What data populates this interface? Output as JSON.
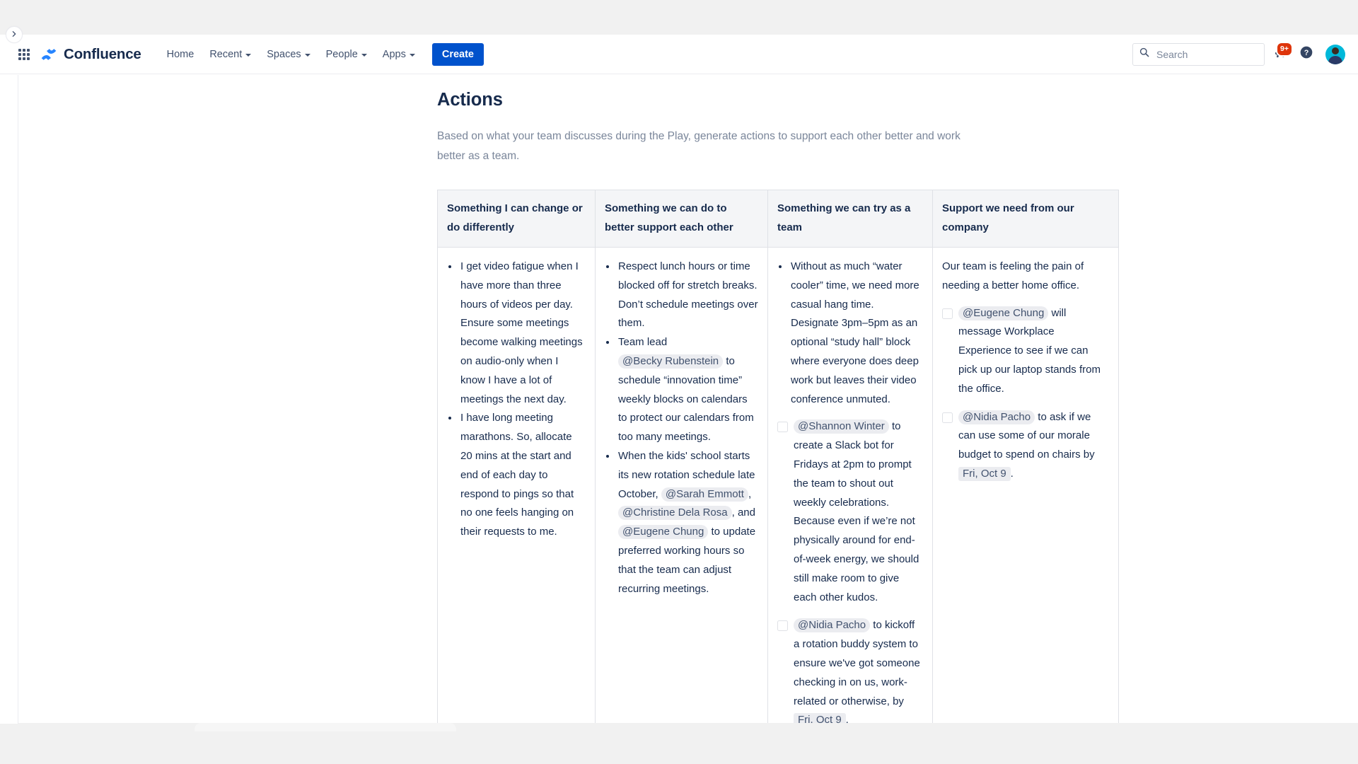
{
  "app": {
    "brand_name": "Confluence",
    "app_switcher_icon": "grid-apps-icon",
    "logo_icon": "confluence-logo-icon"
  },
  "topnav": {
    "items": [
      {
        "label": "Home",
        "has_caret": false
      },
      {
        "label": "Recent",
        "has_caret": true
      },
      {
        "label": "Spaces",
        "has_caret": true
      },
      {
        "label": "People",
        "has_caret": true
      },
      {
        "label": "Apps",
        "has_caret": true
      }
    ],
    "create_label": "Create",
    "search": {
      "placeholder": "Search",
      "value": "",
      "icon": "search-icon"
    },
    "notifications": {
      "badge": "9+",
      "icon": "megaphone-icon"
    },
    "help": {
      "icon": "help-circle-icon"
    },
    "avatar": {
      "icon": "user-avatar"
    }
  },
  "sidebar": {
    "expand_icon": "chevron-right-icon"
  },
  "page": {
    "title": "Actions",
    "subtitle": "Based on what your team discusses during the Play, generate actions to support each other better and work better as a team."
  },
  "table": {
    "headers": [
      "Something I can change or do differently",
      "Something we can do to better support each other",
      "Something we can try as a team",
      "Support we need from our company"
    ],
    "col1": {
      "bullets": [
        "I get video fatigue when I have more than three hours of videos per day. Ensure some meetings become walking meetings on audio-only when I know I have a lot of meetings the next day.",
        "I have long meeting marathons. So, allocate 20 mins at the start and end of each day to respond to pings so that no one feels hanging on their requests to me."
      ]
    },
    "col2": {
      "bullet1": "Respect lunch hours or time blocked off for stretch breaks. Don’t schedule meetings over them.",
      "bullet2_pre": "Team lead",
      "bullet2_mention": "@Becky Rubenstein",
      "bullet2_post": "to schedule “innovation time” weekly blocks on calendars to protect our calendars from too many meetings.",
      "bullet3_pre": "When the kids' school starts its new rotation schedule late October,",
      "bullet3_mention1": "@Sarah Emmott",
      "bullet3_sep1": ",",
      "bullet3_mention2": "@Christine Dela Rosa",
      "bullet3_sep2": ",",
      "bullet3_and": "and",
      "bullet3_mention3": "@Eugene Chung",
      "bullet3_post": "to update preferred working hours so that the team can adjust recurring meetings."
    },
    "col3": {
      "bullet1": "Without as much “water cooler” time, we need more casual hang time. Designate 3pm–5pm as an optional “study hall” block where everyone does deep work but leaves their video conference unmuted.",
      "task1": {
        "checked": false,
        "mention": "@Shannon Winter",
        "text": "to create a Slack bot for Fridays at 2pm to prompt the team to shout out weekly celebrations. Because even if we’re not physically around for end-of-week energy, we should still make room to give each other kudos."
      },
      "task2": {
        "checked": false,
        "mention": "@Nidia Pacho",
        "text_pre": "to kickoff a rotation buddy system to ensure we've got someone checking in on us, work-related or otherwise, by",
        "date": "Fri, Oct 9",
        "text_post": "."
      }
    },
    "col4": {
      "intro": "Our team is feeling the pain of needing a better home office.",
      "task1": {
        "checked": false,
        "mention": "@Eugene Chung",
        "text": "will message Workplace Experience to see if we can pick up our laptop stands from the office."
      },
      "task2": {
        "checked": false,
        "mention": "@Nidia Pacho",
        "text_pre": "to ask if we can use some of our morale budget to spend on chairs by",
        "date": "Fri, Oct 9",
        "text_post": "."
      }
    }
  },
  "colors": {
    "brand_blue": "#0052cc",
    "logo_blue": "#2684ff",
    "text_primary": "#172b4d",
    "text_muted": "#7a869a",
    "border": "#dfe1e6",
    "header_bg": "#f4f5f7",
    "chip_bg": "#ebecf0",
    "badge_red": "#de350b"
  }
}
